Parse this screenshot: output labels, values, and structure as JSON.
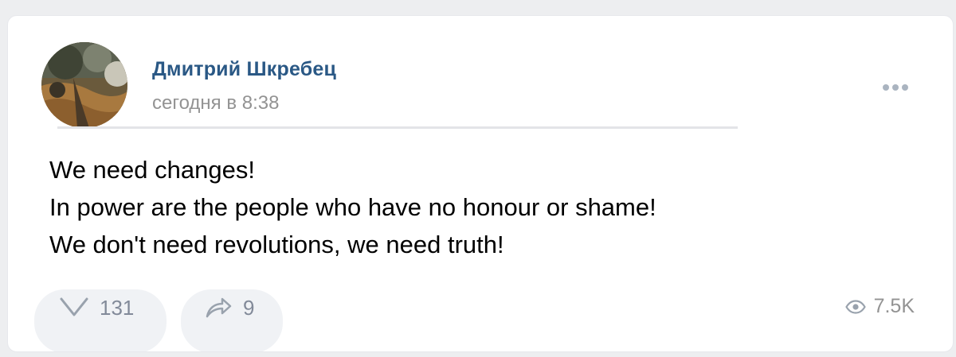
{
  "post": {
    "author_name": "Дмитрий Шкребец",
    "timestamp": "сегодня в 8:38",
    "text_lines": [
      "We need changes!",
      "In power are the people who have no honour or shame!",
      "We don't need revolutions, we need truth!"
    ]
  },
  "actions": {
    "likes": "131",
    "shares": "9",
    "views": "7.5K"
  },
  "icons": {
    "avatar": "user-avatar-photo",
    "more": "more-dots-icon",
    "like": "heart-icon",
    "share": "share-arrow-icon",
    "views": "eye-icon"
  },
  "colors": {
    "author_link": "#2a5885",
    "secondary_text": "#939393",
    "action_text": "#828a99",
    "pill_bg": "#f0f2f5",
    "page_bg": "#edeef0"
  }
}
